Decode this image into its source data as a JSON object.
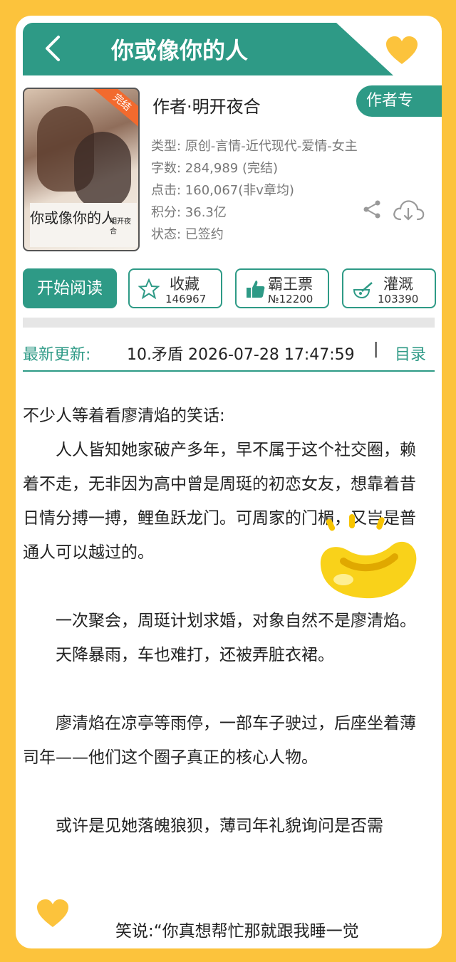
{
  "header": {
    "title": "你或像你的人"
  },
  "book": {
    "cover_badge": "完结",
    "cover_title": "你或像你的人",
    "cover_author": "明开夜合",
    "author": "作者·明开夜合",
    "author_button": "作者专",
    "meta": [
      "类型: 原创-言情-近代现代-爱情-女主",
      "字数: 284,989 (完结)",
      "点击: 160,067(非v章均)",
      "积分: 36.3亿",
      "状态: 已签约"
    ]
  },
  "actions": {
    "read": "开始阅读",
    "favorite": {
      "label": "收藏",
      "count": "146967"
    },
    "ticket": {
      "label": "霸王票",
      "count": "№12200"
    },
    "water": {
      "label": "灌溉",
      "count": "103390"
    }
  },
  "update": {
    "label": "最新更新:",
    "text": "10.矛盾  2026-07-28 17:47:59",
    "separator": "|",
    "toc": "目录"
  },
  "content": {
    "p1": "不少人等着看廖清焰的笑话:",
    "p2": "人人皆知她家破产多年，早不属于这个社交圈，赖着不走，无非因为高中曾是周珽的初恋女友，想靠着昔日情分搏一搏，鲤鱼跃龙门。可周家的门楣，又岂是普通人可以越过的。",
    "p3": "一次聚会，周珽计划求婚，对象自然不是廖清焰。",
    "p4": "天降暴雨，车也难打，还被弄脏衣裙。",
    "p5": "廖清焰在凉亭等雨停，一部车子驶过，后座坐着薄司年——他们这个圈子真正的核心人物。",
    "p6": "或许是见她落魄狼狈，薄司年礼貌询问是否需",
    "p7": "笑说:“你真想帮忙那就跟我睡一觉"
  },
  "colors": {
    "accent": "#2e9a86",
    "frame": "#fcc33c"
  }
}
